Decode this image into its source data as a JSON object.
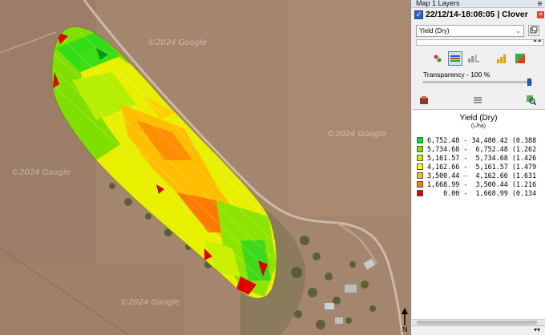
{
  "panel": {
    "title": "Map 1 Layers",
    "layer": {
      "name": "22/12/14-18:08:05 | Clover",
      "checked": true
    },
    "attribute": {
      "selected": "Yield (Dry)"
    },
    "transparency_label": "Transparency - 100 %",
    "transparency_value": 1.0
  },
  "map": {
    "watermarks": [
      "©2024 Google",
      "©2024 Google",
      "©2024 Google",
      "©2024 Google"
    ],
    "north_label": "N"
  },
  "legend": {
    "title": "Yield (Dry)",
    "unit": "(L/ha)",
    "rows": [
      {
        "text": "6,752.48 - 34,480.42 (0.388",
        "color": "#00e020"
      },
      {
        "text": "5,734.68 -  6,752.48 (1.262",
        "color": "#7fe000"
      },
      {
        "text": "5,161.57 -  5,734.68 (1.426",
        "color": "#c8f000"
      },
      {
        "text": "4,162.66 -  5,161.57 (1.479",
        "color": "#ffff00"
      },
      {
        "text": "3,500.44 -  4,162.66 (1.631",
        "color": "#ffc000"
      },
      {
        "text": "1,668.99 -  3,500.44 (1.216",
        "color": "#ff7a00"
      },
      {
        "text": "    0.00 -  1,668.99 (0.134",
        "color": "#e00000"
      }
    ]
  }
}
